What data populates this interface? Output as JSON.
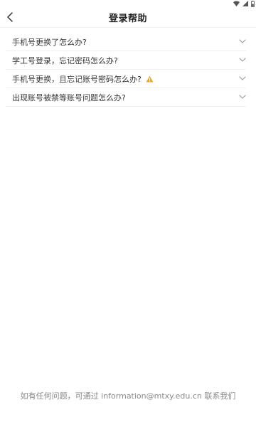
{
  "header": {
    "title": "登录帮助"
  },
  "faq": [
    {
      "question": "手机号更换了怎么办?",
      "warning": false
    },
    {
      "question": "学工号登录，忘记密码怎么办?",
      "warning": false
    },
    {
      "question": "手机号更换，且忘记账号密码怎么办?",
      "warning": true
    },
    {
      "question": "出现账号被禁等账号问题怎么办?",
      "warning": false
    }
  ],
  "footer": {
    "prefix": "如有任何问题，可通过",
    "email": "information@mtxy.edu.cn",
    "suffix": "联系我们"
  },
  "icons": {
    "back": "chevron-left-icon",
    "expand": "chevron-down-icon",
    "warning": "warning-triangle-icon",
    "wifi": "wifi-icon",
    "signal": "signal-icon",
    "battery": "battery-icon"
  },
  "colors": {
    "warning": "#f5a623",
    "chevron": "#9a9a9a",
    "footer_text": "#8a8a8a"
  }
}
